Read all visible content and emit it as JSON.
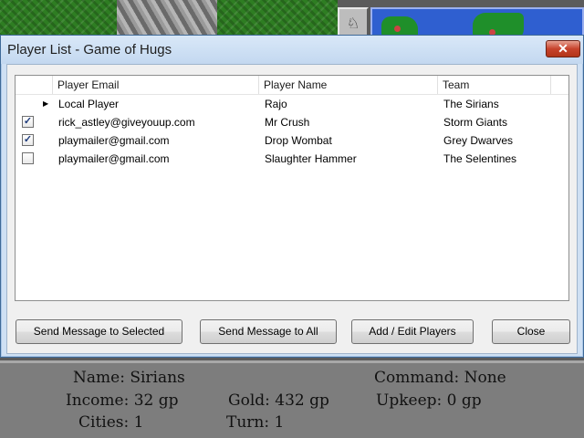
{
  "dialog": {
    "title": "Player List - Game of Hugs",
    "close_glyph": "✕"
  },
  "grid": {
    "columns": [
      {
        "label": ""
      },
      {
        "label": "Player Email"
      },
      {
        "label": "Player Name"
      },
      {
        "label": "Team"
      }
    ],
    "rows": [
      {
        "checkbox": "none",
        "arrow": true,
        "email": "Local Player",
        "name": "Rajo",
        "team": "The Sirians"
      },
      {
        "checkbox": "checked",
        "arrow": false,
        "email": "rick_astley@giveyouup.com",
        "name": "Mr Crush",
        "team": "Storm Giants"
      },
      {
        "checkbox": "checked",
        "arrow": false,
        "email": "playmailer@gmail.com",
        "name": "Drop Wombat",
        "team": "Grey Dwarves"
      },
      {
        "checkbox": "unchecked",
        "arrow": false,
        "email": "playmailer@gmail.com",
        "name": "Slaughter Hammer",
        "team": "The Selentines"
      }
    ]
  },
  "buttons": {
    "send_selected": "Send Message to Selected",
    "send_all": "Send Message to All",
    "add_edit": "Add / Edit Players",
    "close": "Close"
  },
  "game": {
    "tool_glyph": "♘",
    "status": {
      "name": "Name: Sirians",
      "command": "Command: None",
      "income": "Income: 32 gp",
      "gold": "Gold: 432 gp",
      "upkeep": "Upkeep: 0 gp",
      "cities": "Cities: 1",
      "turn": "Turn: 1"
    }
  },
  "colors": {
    "titlebar": "#c3d8f0",
    "close_button": "#c7432c",
    "map_grass": "#2e7d22",
    "minimap_water": "#2f5fd0"
  }
}
